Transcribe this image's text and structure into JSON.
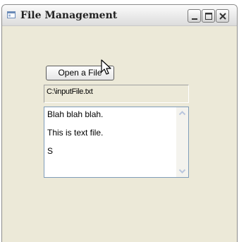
{
  "window": {
    "title": "File Management",
    "minimize_label": "Minimize",
    "maximize_label": "Maximize",
    "close_label": "Close"
  },
  "content": {
    "open_button_label": "Open a File",
    "file_path": "C:\\inputFile.txt",
    "text_lines": [
      "Blah blah blah.",
      "This is text file.",
      "S"
    ]
  },
  "icons": {
    "app": "app-window-icon",
    "minimize": "minimize-icon",
    "maximize": "maximize-icon",
    "close": "close-icon",
    "scroll_up": "chevron-up-icon",
    "scroll_down": "chevron-down-icon",
    "cursor": "mouse-pointer-icon"
  },
  "colors": {
    "window_bg": "#ece9d8",
    "textbox_border": "#7f9db9",
    "scroll_arrow": "#b9c6dd"
  }
}
